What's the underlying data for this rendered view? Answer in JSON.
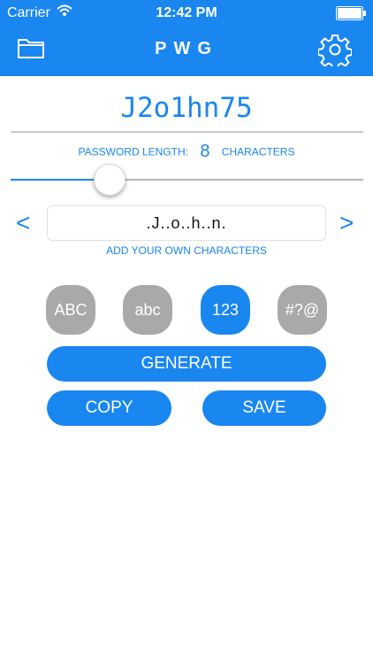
{
  "status": {
    "carrier": "Carrier",
    "time": "12:42 PM"
  },
  "header": {
    "title": "PWG"
  },
  "password": {
    "value": "J2o1hn75"
  },
  "length": {
    "label": "PASSWORD LENGTH:",
    "value": "8",
    "unit": "CHARACTERS",
    "slider_level": 0.28
  },
  "custom": {
    "value": ".J..o..h..n.",
    "caption": "ADD YOUR OWN CHARACTERS",
    "prev": "<",
    "next": ">"
  },
  "toggles": [
    {
      "label": "ABC",
      "on": false
    },
    {
      "label": "abc",
      "on": false
    },
    {
      "label": "123",
      "on": true
    },
    {
      "label": "#?@",
      "on": false
    }
  ],
  "buttons": {
    "generate": "GENERATE",
    "copy": "COPY",
    "save": "SAVE"
  },
  "colors": {
    "accent": "#1a86f0",
    "toggle_off": "#a9a9a9"
  }
}
